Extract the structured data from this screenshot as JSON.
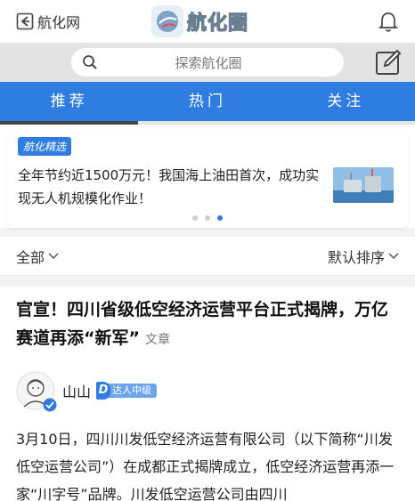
{
  "header": {
    "back_label": "航化网",
    "logo_text": "航化圈"
  },
  "search": {
    "placeholder": "探索航化圈"
  },
  "tabs": [
    {
      "label": "推荐",
      "active": true
    },
    {
      "label": "热门",
      "active": false
    },
    {
      "label": "关注",
      "active": false
    }
  ],
  "featured": {
    "tag": "航化精选",
    "headline": "全年节约近1500万元！我国海上油田首次，成功实现无人机规模化作业！",
    "dots_total": 3,
    "dots_active": 3
  },
  "filters": {
    "left": "全部",
    "right": "默认排序"
  },
  "article": {
    "title": "官宣！四川省级低空经济运营平台正式揭牌，万亿赛道再添“新军”",
    "type_label": "文章",
    "author": "山山",
    "author_level": "达人中级",
    "body": "3月10日，四川川发低空经济运营有限公司（以下简称“川发低空运营公司”）在成都正式揭牌成立，低空经济运营再添一家“川字号”品牌。川发低空运营公司由四川"
  },
  "colors": {
    "accent": "#2f7de1",
    "search_bar_bg": "#e3e3e3"
  }
}
